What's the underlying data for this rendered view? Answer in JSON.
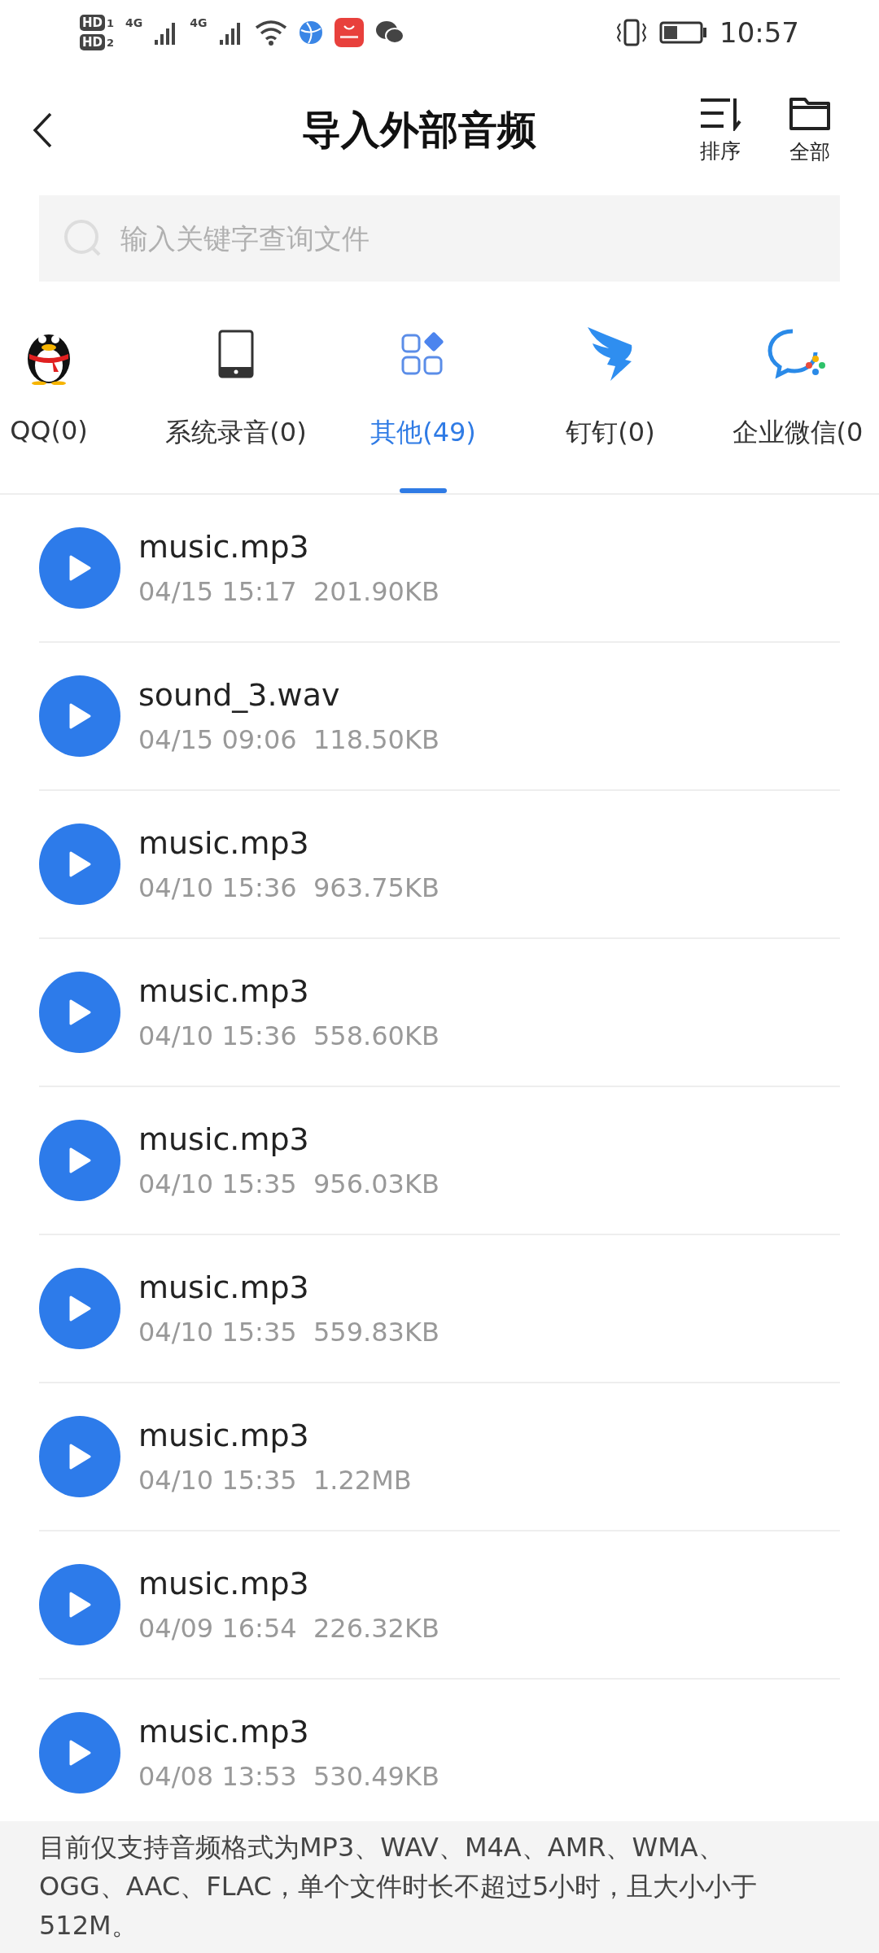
{
  "status_bar": {
    "sims": [
      {
        "label": "HD",
        "slot": "1",
        "network": "4G"
      },
      {
        "label": "HD",
        "slot": "2",
        "network": "4G"
      }
    ],
    "time": "10:57"
  },
  "header": {
    "title": "导入外部音频",
    "actions": [
      {
        "kind": "sort",
        "label": "排序"
      },
      {
        "kind": "folder",
        "label": "全部"
      }
    ]
  },
  "search": {
    "placeholder": "输入关键字查询文件"
  },
  "tabs": [
    {
      "kind": "qq",
      "label": "QQ(0)",
      "selected": false
    },
    {
      "kind": "phone",
      "label": "系统录音(0)",
      "selected": false
    },
    {
      "kind": "apps",
      "label": "其他(49)",
      "selected": true
    },
    {
      "kind": "dingtalk",
      "label": "钉钉(0)",
      "selected": false
    },
    {
      "kind": "wecom",
      "label": "企业微信(0",
      "selected": false
    }
  ],
  "files": [
    {
      "name": "music.mp3",
      "date": "04/15 15:17",
      "size": "201.90KB"
    },
    {
      "name": "sound_3.wav",
      "date": "04/15 09:06",
      "size": "118.50KB"
    },
    {
      "name": "music.mp3",
      "date": "04/10 15:36",
      "size": "963.75KB"
    },
    {
      "name": "music.mp3",
      "date": "04/10 15:36",
      "size": "558.60KB"
    },
    {
      "name": "music.mp3",
      "date": "04/10 15:35",
      "size": "956.03KB"
    },
    {
      "name": "music.mp3",
      "date": "04/10 15:35",
      "size": "559.83KB"
    },
    {
      "name": "music.mp3",
      "date": "04/10 15:35",
      "size": "1.22MB"
    },
    {
      "name": "music.mp3",
      "date": "04/09 16:54",
      "size": "226.32KB"
    },
    {
      "name": "music.mp3",
      "date": "04/08 13:53",
      "size": "530.49KB"
    }
  ],
  "footer_note": "目前仅支持音频格式为MP3、WAV、M4A、AMR、WMA、OGG、AAC、FLAC，单个文件时长不超过5小时，且大小小于512M。"
}
